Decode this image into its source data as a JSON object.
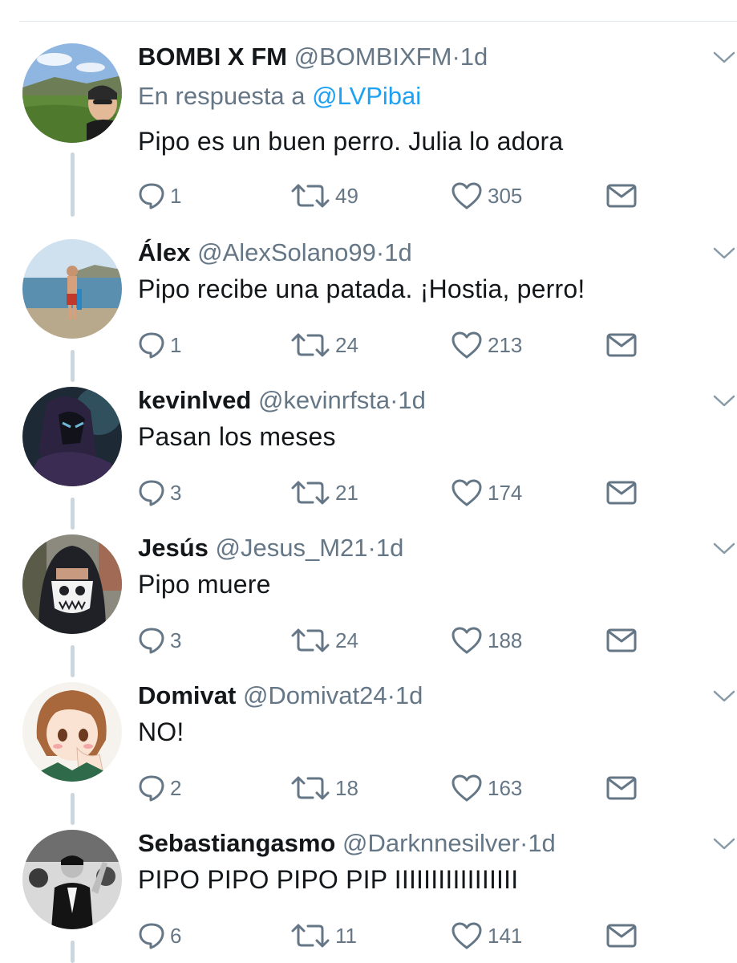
{
  "thread": [
    {
      "name": "BOMBI X FM",
      "handle": "@BOMBIXFM",
      "time": "1d",
      "reply_prefix": "En respuesta a",
      "reply_mention": "@LVPibai",
      "text": "Pipo es un buen perro. Julia lo adora",
      "replies": "1",
      "retweets": "49",
      "likes": "305",
      "avatar": "landscape-portrait"
    },
    {
      "name": "Álex",
      "handle": "@AlexSolano99",
      "time": "1d",
      "text": "Pipo recibe una patada. ¡Hostia, perro!",
      "replies": "1",
      "retweets": "24",
      "likes": "213",
      "avatar": "beach-person"
    },
    {
      "name": "kevinlved",
      "handle": "@kevinrfsta",
      "time": "1d",
      "text": "Pasan los meses",
      "replies": "3",
      "retweets": "21",
      "likes": "174",
      "avatar": "dark-hooded-character"
    },
    {
      "name": "Jesús",
      "handle": "@Jesus_M21",
      "time": "1d",
      "text": "Pipo muere",
      "replies": "3",
      "retweets": "24",
      "likes": "188",
      "avatar": "skull-mask-hood"
    },
    {
      "name": "Domivat",
      "handle": "@Domivat24",
      "time": "1d",
      "text": "NO!",
      "replies": "2",
      "retweets": "18",
      "likes": "163",
      "avatar": "anime-girl"
    },
    {
      "name": "Sebastiangasmo",
      "handle": "@Darknnesilver",
      "time": "1d",
      "text": "PIPO PIPO PIPO PIP IIIIIIIIIIIIIIIII",
      "replies": "6",
      "retweets": "11",
      "likes": "141",
      "avatar": "black-white-crowd"
    }
  ],
  "separator": "·",
  "icons": {
    "reply": "reply-icon",
    "retweet": "retweet-icon",
    "like": "heart-icon",
    "dm": "envelope-icon",
    "menu": "chevron-down-icon"
  },
  "colors": {
    "name": "#14171a",
    "secondary": "#657786",
    "mention": "#1da1f2",
    "thread_line": "#ccd6dd"
  }
}
